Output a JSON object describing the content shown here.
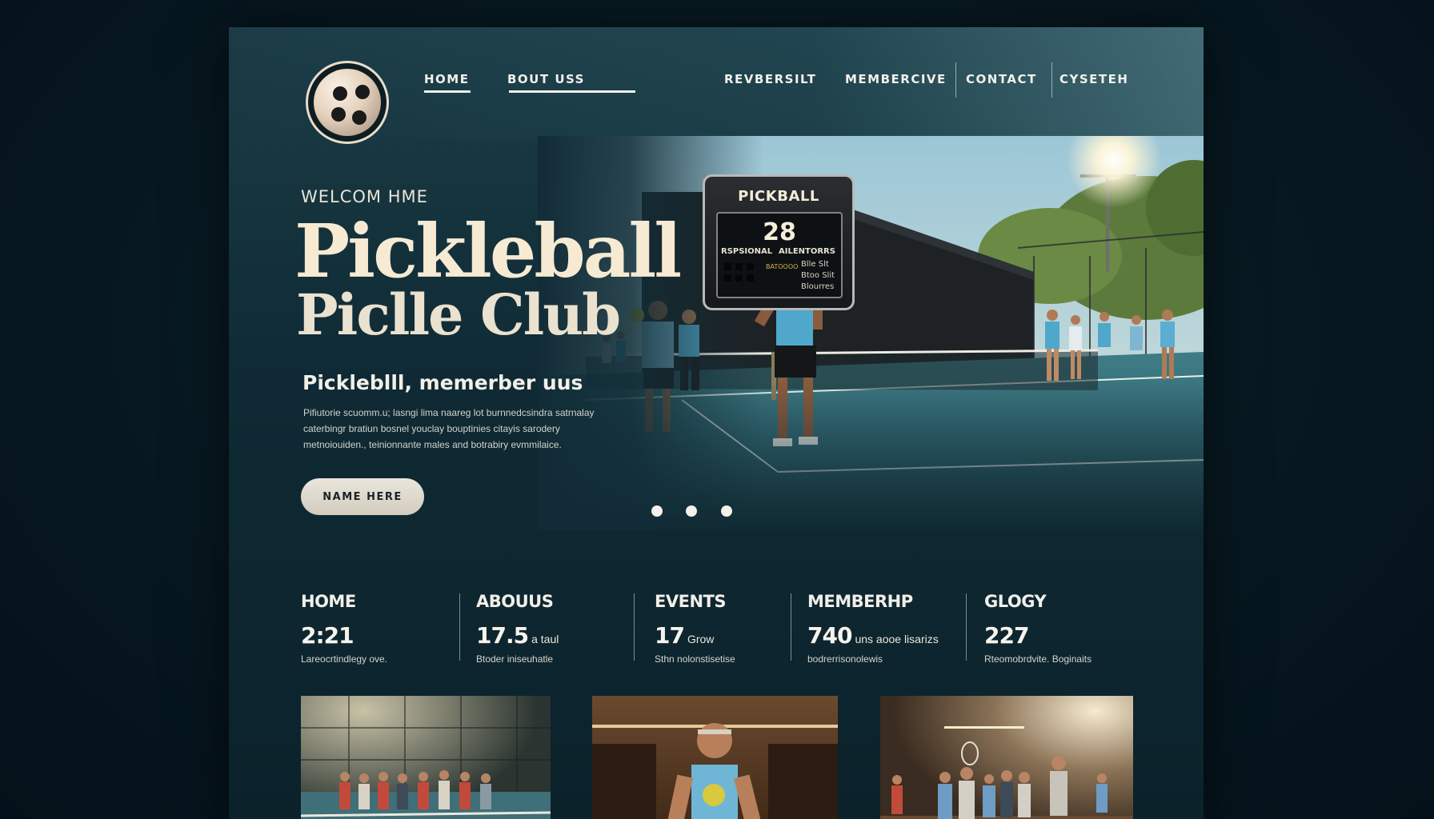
{
  "nav": {
    "items": [
      {
        "label": "HOME",
        "active": true
      },
      {
        "label": "BOUT USS"
      },
      {
        "label": "REVBERSILT"
      },
      {
        "label": "MEMBERCIVE"
      },
      {
        "label": "CONTACT"
      },
      {
        "label": "CYSETEH"
      }
    ]
  },
  "scoreboard": {
    "title": "PICKBALL",
    "score": "28",
    "col_left": "RSPSIONAL",
    "col_right": "AILENTORRS",
    "lines": [
      "Blle Slt",
      "Btoo Slit",
      "Blourres"
    ],
    "small_label": "BATOOOO"
  },
  "hero": {
    "welcome": "WELCOM HME",
    "title_line1": "Pickleball",
    "title_line2": "Piclle Club",
    "subtitle": "Pickleblll, memerber uus",
    "description": "Pifiutorie scuomm.u; lasngi lima naareg lot burnnedcsindra satrnalay caterbingr bratiun bosnel youclay bouptinies citayis sarodery metnoiouiden., teinionnante males and botrabiry evmmilaice.",
    "cta_label": "NAME HERE",
    "carousel_dots": 3
  },
  "stats": [
    {
      "label": "HOME",
      "number": "2:21",
      "unit": "",
      "caption": "Lareocrtindlegy ove."
    },
    {
      "label": "ABOUUS",
      "number": "17.5",
      "unit": "a taul",
      "caption": "Btoder iniseuhatle"
    },
    {
      "label": "EVENTS",
      "number": "17",
      "unit": "Grow",
      "caption": "Sthn nolonstisetise"
    },
    {
      "label": "MEMBERHP",
      "number": "740",
      "unit": "uns aooe lisarizs",
      "caption": "bodrerrisonolewis"
    },
    {
      "label": "GLOGY",
      "number": "227",
      "unit": "",
      "caption": "Rteomobrdvite. Boginaits"
    }
  ],
  "colors": {
    "background": "#071820",
    "panel": "#0f2a34",
    "cream": "#f6ead3",
    "accent_blue": "#4fa7cc"
  }
}
